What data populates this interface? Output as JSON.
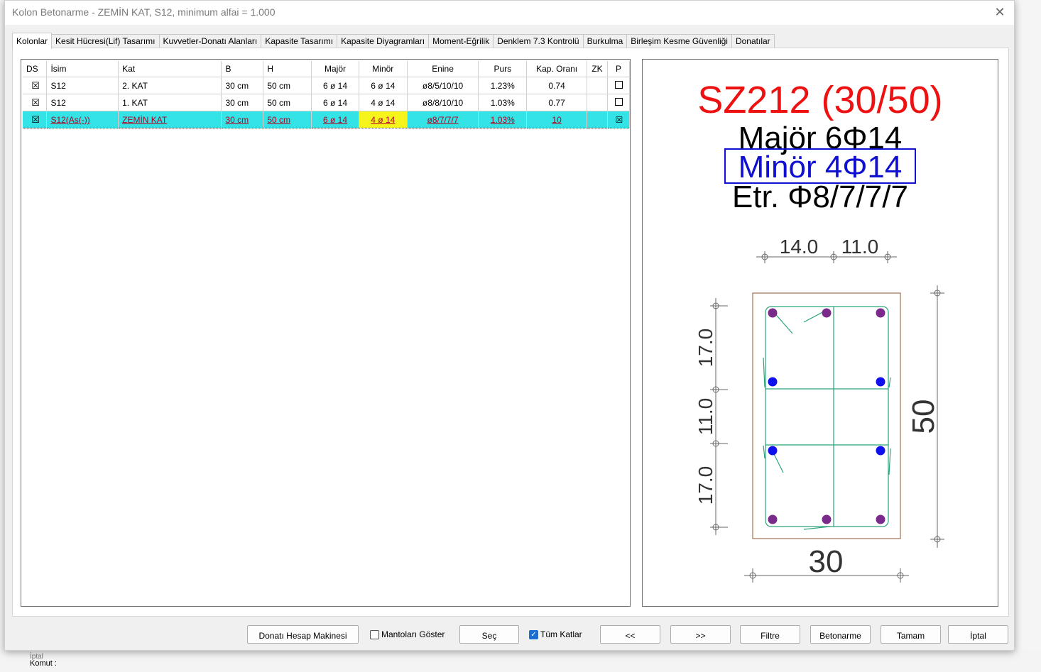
{
  "window": {
    "title": "Kolon Betonarme - ZEMİN KAT, S12, minimum alfai = 1.000",
    "close": "✕"
  },
  "tabs": [
    "Kolonlar",
    "Kesit Hücresi(Lif) Tasarımı",
    "Kuvvetler-Donatı Alanları",
    "Kapasite Tasarımı",
    "Kapasite Diyagramları",
    "Moment-Eğrilik",
    "Denklem 7.3 Kontrolü",
    "Burkulma",
    "Birleşim Kesme Güvenliği",
    "Donatılar"
  ],
  "table": {
    "headers": [
      "DS",
      "İsim",
      "Kat",
      "B",
      "H",
      "Majör",
      "Minör",
      "Enine",
      "Purs",
      "Kap. Oranı",
      "ZK",
      "P"
    ],
    "rows": [
      {
        "ds": "☒",
        "isim": "S12",
        "kat": "2. KAT",
        "b": "30 cm",
        "h": "50 cm",
        "major": "6 ø 14",
        "minor": "6 ø 14",
        "enine": "ø8/5/10/10",
        "purs": "1.23%",
        "kap": "0.74",
        "zk": "",
        "p": ""
      },
      {
        "ds": "☒",
        "isim": "S12",
        "kat": "1. KAT",
        "b": "30 cm",
        "h": "50 cm",
        "major": "6 ø 14",
        "minor": "4 ø 14",
        "enine": "ø8/8/10/10",
        "purs": "1.03%",
        "kap": "0.77",
        "zk": "",
        "p": ""
      },
      {
        "ds": "☒",
        "isim": "S12(As(-))",
        "kat": "ZEMİN KAT",
        "b": "30 cm",
        "h": "50 cm",
        "major": "6 ø 14",
        "minor": "4 ø 14",
        "enine": "ø8/7/7/7",
        "purs": "1.03%",
        "kap": "10",
        "zk": "",
        "p": "☒"
      }
    ]
  },
  "preview": {
    "name": "SZ212 (30/50)",
    "major": "Majör 6Φ14",
    "minor": "Minör 4Φ14",
    "etr": "Etr. Φ8/7/7/7",
    "dim_top_a": "14.0",
    "dim_top_b": "11.0",
    "dim_left_a": "17.0",
    "dim_left_b": "11.0",
    "dim_left_c": "17.0",
    "dim_height": "50",
    "dim_width": "30",
    "colors": {
      "name": "#ee1111",
      "minor": "#1010d0",
      "corner_bar": "#7a2a8a",
      "mid_bar": "#1010ee",
      "stirrup": "#2aa37a"
    }
  },
  "footer": {
    "calc": "Donatı Hesap Makinesi",
    "manto": "Mantoları Göster",
    "sec": "Seç",
    "tum": "Tüm Katlar",
    "prev": "<<",
    "next": ">>",
    "filtre": "Filtre",
    "betonarme": "Betonarme",
    "tamam": "Tamam",
    "iptal": "İptal"
  },
  "background": {
    "komut": "Komut :",
    "iptal_hint": "İptal"
  }
}
